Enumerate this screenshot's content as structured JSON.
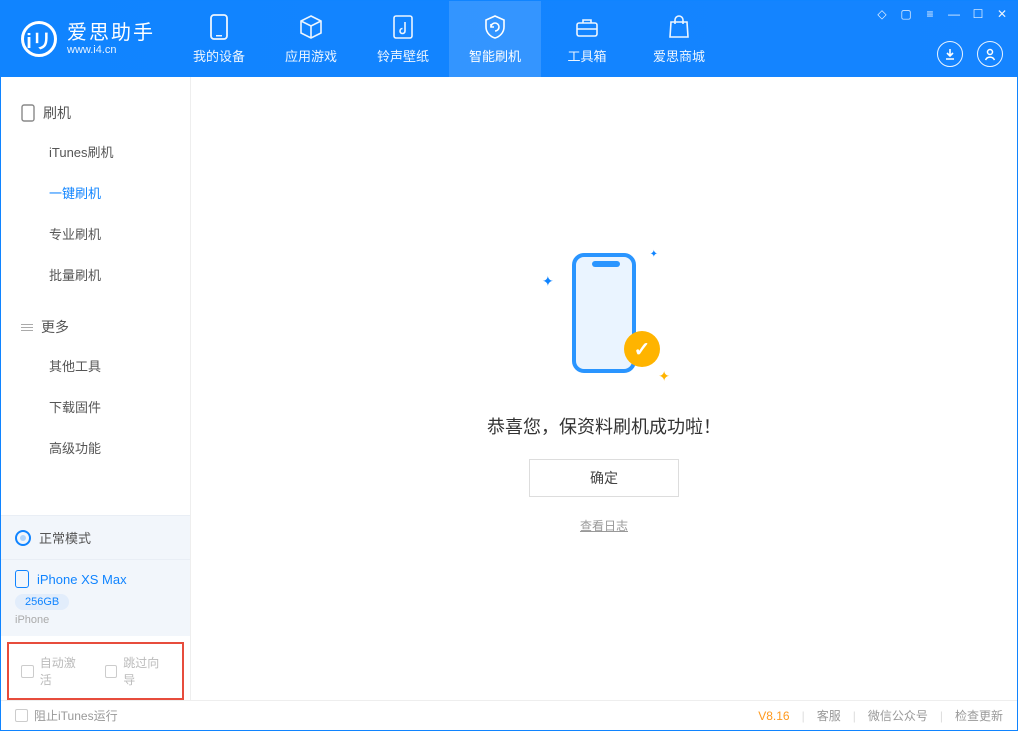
{
  "app": {
    "title": "爱思助手",
    "subtitle": "www.i4.cn"
  },
  "tabs": {
    "device": "我的设备",
    "apps": "应用游戏",
    "ringtone": "铃声壁纸",
    "flash": "智能刷机",
    "toolbox": "工具箱",
    "mall": "爱思商城"
  },
  "sidebar": {
    "section_flash": "刷机",
    "items_flash": {
      "itunes": "iTunes刷机",
      "onekey": "一键刷机",
      "pro": "专业刷机",
      "batch": "批量刷机"
    },
    "section_more": "更多",
    "items_more": {
      "othertools": "其他工具",
      "firmware": "下载固件",
      "advanced": "高级功能"
    },
    "mode": "正常模式",
    "device_name": "iPhone XS Max",
    "device_cap": "256GB",
    "device_type": "iPhone",
    "opt_auto_activate": "自动激活",
    "opt_skip_guide": "跳过向导"
  },
  "main": {
    "success": "恭喜您，保资料刷机成功啦！",
    "ok": "确定",
    "view_log": "查看日志"
  },
  "footer": {
    "block_itunes": "阻止iTunes运行",
    "version": "V8.16",
    "service": "客服",
    "wechat": "微信公众号",
    "update": "检查更新"
  }
}
